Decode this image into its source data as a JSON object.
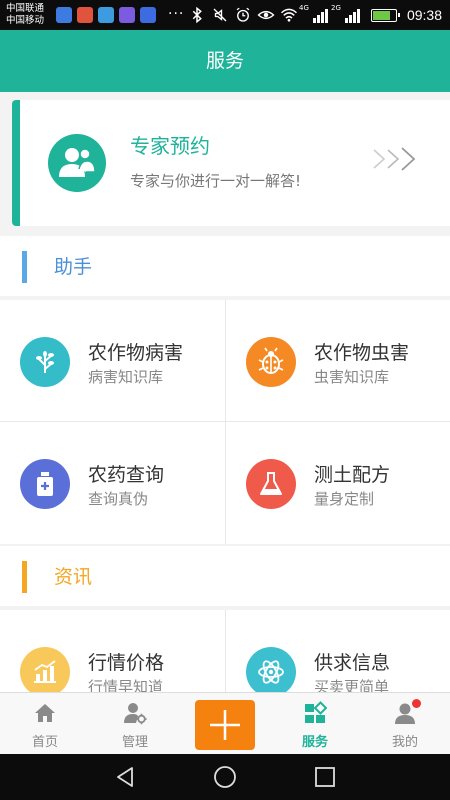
{
  "status_bar": {
    "carrier_1": "中国联通",
    "carrier_2": "中国移动",
    "dots": "···",
    "network_1": "4G",
    "network_2": "2G",
    "time": "09:38",
    "app_icon_colors": [
      "#3d7be0",
      "#e0533d",
      "#3d9be0",
      "#7b5be0",
      "#3d6be0"
    ]
  },
  "header": {
    "title": "服务"
  },
  "expert": {
    "title": "专家预约",
    "subtitle": "专家与你进行一对一解答!",
    "icon": "users-icon",
    "arrow_icon": "triple-chevron-right-icon"
  },
  "sections": {
    "assistant": {
      "label": "助手",
      "bar_color": "#5aa9e6",
      "label_color": "#4a90d9"
    },
    "news": {
      "label": "资讯",
      "bar_color": "#f5a623",
      "label_color": "#f5a623"
    }
  },
  "assistant_items": [
    {
      "title": "农作物病害",
      "subtitle": "病害知识库",
      "icon": "plant-icon",
      "color": "#35bcc9"
    },
    {
      "title": "农作物虫害",
      "subtitle": "虫害知识库",
      "icon": "ladybug-icon",
      "color": "#f58a25"
    },
    {
      "title": "农药查询",
      "subtitle": "查询真伪",
      "icon": "pesticide-bottle-icon",
      "color": "#5b6fd8"
    },
    {
      "title": "测土配方",
      "subtitle": "量身定制",
      "icon": "flask-icon",
      "color": "#ef5a4a"
    }
  ],
  "news_items": [
    {
      "title": "行情价格",
      "subtitle": "行情早知道",
      "icon": "bar-chart-icon",
      "color": "#f8c95a"
    },
    {
      "title": "供求信息",
      "subtitle": "买卖更简单",
      "icon": "atom-icon",
      "color": "#3cc0d0"
    }
  ],
  "bottom_nav": [
    {
      "label": "首页",
      "icon": "home-icon",
      "active": false
    },
    {
      "label": "管理",
      "icon": "user-gear-icon",
      "active": false
    },
    {
      "label": "",
      "icon": "plus-icon",
      "active": false
    },
    {
      "label": "服务",
      "icon": "grid-icon",
      "active": true
    },
    {
      "label": "我的",
      "icon": "profile-icon",
      "active": false
    }
  ],
  "colors": {
    "primary": "#1fb39a",
    "accent": "#f5820f",
    "badge": "#ee3333"
  }
}
